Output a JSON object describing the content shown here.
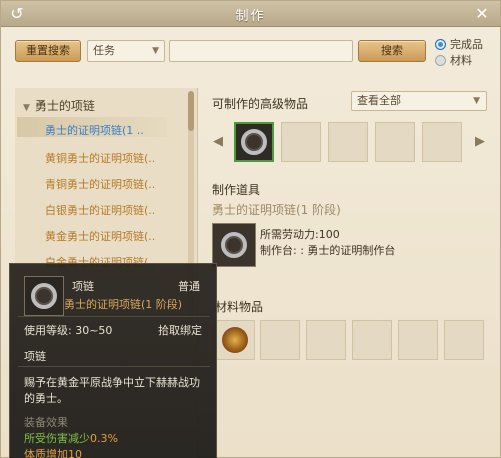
{
  "window": {
    "title": "制作"
  },
  "toolbar": {
    "reset_label": "重置搜索",
    "category_value": "任务",
    "search_placeholder": "",
    "search_label": "搜索",
    "radio_finished": "完成品",
    "radio_material": "材料"
  },
  "tree": {
    "header": "勇士的项链",
    "items": [
      {
        "label": "勇士的证明项链(1 .."
      },
      {
        "label": "黄铜勇士的证明项链(.."
      },
      {
        "label": "青铜勇士的证明项链(.."
      },
      {
        "label": "白银勇士的证明项链(.."
      },
      {
        "label": "黄金勇士的证明项链(.."
      },
      {
        "label": "白金勇士的证明项链(.."
      }
    ]
  },
  "craftable": {
    "label": "可制作的高级物品",
    "filter_value": "查看全部"
  },
  "tool": {
    "label": "制作道具",
    "name": "勇士的证明项链(1 阶段)",
    "labor": "所需劳动力:100",
    "station": "制作台: : 勇士的证明制作台"
  },
  "materials": {
    "label": "材料物品"
  },
  "tooltip": {
    "type": "项链",
    "grade": "普通",
    "name": "勇士的证明项链(1 阶段)",
    "level": "使用等级: 30~50",
    "bind": "拾取绑定",
    "category": "项链",
    "desc1": "赐予在黄金平原战争中立下赫赫战功",
    "desc2": "的勇士。",
    "effect_title": "装备效果",
    "effect1": "所受伤害减少",
    "effect1_val": "0.3%",
    "effect2": "体质增加10"
  },
  "colors": {
    "accent_gold": "#c99a56",
    "selected_blue": "#3b7dc6",
    "tree_text": "#b57b28",
    "effect_green": "#7bc043",
    "effect_orange": "#e0a040"
  }
}
